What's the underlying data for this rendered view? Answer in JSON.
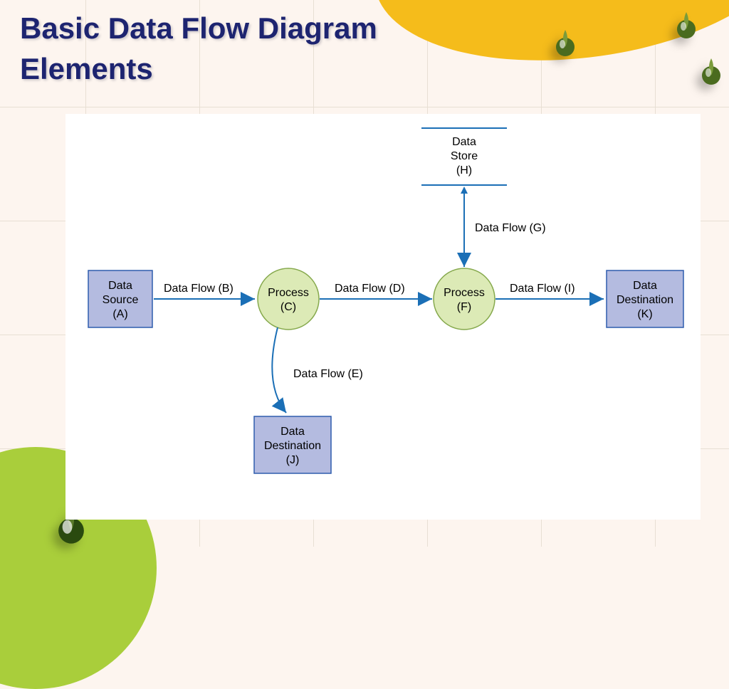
{
  "title_line1": "Basic Data Flow Diagram",
  "title_line2": "Elements",
  "colors": {
    "accent_yellow": "#f5bc1b",
    "accent_green": "#a9ce3b",
    "title_color": "#1d2470",
    "connector": "#1b6fb6",
    "entity_fill": "#b4bbe0",
    "entity_stroke": "#2e5dad",
    "process_fill": "#dceab6",
    "process_stroke": "#86a94d"
  },
  "diagram": {
    "data_store": {
      "line1": "Data",
      "line2": "Store",
      "line3": "(H)"
    },
    "source_a": {
      "line1": "Data",
      "line2": "Source",
      "line3": "(A)"
    },
    "process_c": {
      "line1": "Process",
      "line2": "(C)"
    },
    "process_f": {
      "line1": "Process",
      "line2": "(F)"
    },
    "dest_j": {
      "line1": "Data",
      "line2": "Destination",
      "line3": "(J)"
    },
    "dest_k": {
      "line1": "Data",
      "line2": "Destination",
      "line3": "(K)"
    },
    "flow_b": "Data Flow (B)",
    "flow_d": "Data Flow (D)",
    "flow_e": "Data Flow (E)",
    "flow_g": "Data Flow (G)",
    "flow_i": "Data Flow (I)"
  }
}
